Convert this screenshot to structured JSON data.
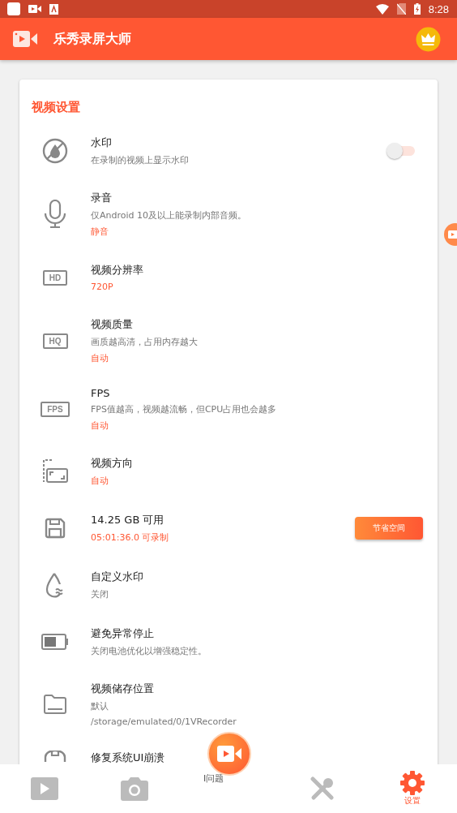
{
  "status_bar": {
    "time": "8:28"
  },
  "app_bar": {
    "title": "乐秀录屏大师"
  },
  "section": {
    "title": "视频设置"
  },
  "rows": [
    {
      "kind": "toggle",
      "title": "水印",
      "on": false,
      "lines": [
        {
          "text": "在录制的视频上显示水印",
          "highlighted": false
        }
      ]
    },
    {
      "kind": "plain",
      "title": "录音",
      "lines": [
        {
          "text": "仅Android 10及以上能录制内部音频。",
          "highlighted": false
        },
        {
          "text": "静音",
          "highlighted": true
        }
      ]
    },
    {
      "kind": "plain",
      "badge": "HD",
      "title": "视频分辨率",
      "lines": [
        {
          "text": "720P",
          "highlighted": true
        }
      ]
    },
    {
      "kind": "plain",
      "badge": "HQ",
      "title": "视频质量",
      "lines": [
        {
          "text": "画质越高清，占用内存越大",
          "highlighted": false
        },
        {
          "text": "自动",
          "highlighted": true
        }
      ]
    },
    {
      "kind": "plain",
      "badge": "FPS",
      "title": "FPS",
      "lines": [
        {
          "text": "FPS值越高，视频越流畅，但CPU占用也会越多",
          "highlighted": false
        },
        {
          "text": "自动",
          "highlighted": true
        }
      ]
    },
    {
      "kind": "plain",
      "title": "视频方向",
      "lines": [
        {
          "text": "自动",
          "highlighted": true
        }
      ]
    },
    {
      "kind": "button",
      "title": "14.25 GB 可用",
      "button": "节省空间",
      "lines": [
        {
          "text": "05:01:36.0 可录制",
          "highlighted": true
        }
      ]
    },
    {
      "kind": "plain",
      "title": "自定义水印",
      "lines": [
        {
          "text": "关闭",
          "highlighted": false
        }
      ]
    },
    {
      "kind": "plain",
      "title": "避免异常停止",
      "lines": [
        {
          "text": "关闭电池优化以增强稳定性。",
          "highlighted": false
        }
      ]
    },
    {
      "kind": "plain",
      "title": "视频储存位置",
      "lines": [
        {
          "text": "默认",
          "highlighted": false
        },
        {
          "text": "/storage/emulated/0/1VRecorder",
          "highlighted": false
        }
      ]
    },
    {
      "kind": "plain",
      "title": "修复系统UI崩溃"
    }
  ],
  "bottom_nav": {
    "peek_text": "I问题",
    "items": [
      {
        "selected": false
      },
      {
        "selected": false
      },
      {
        "selected": false
      },
      {
        "label": "设置",
        "selected": true
      }
    ]
  }
}
